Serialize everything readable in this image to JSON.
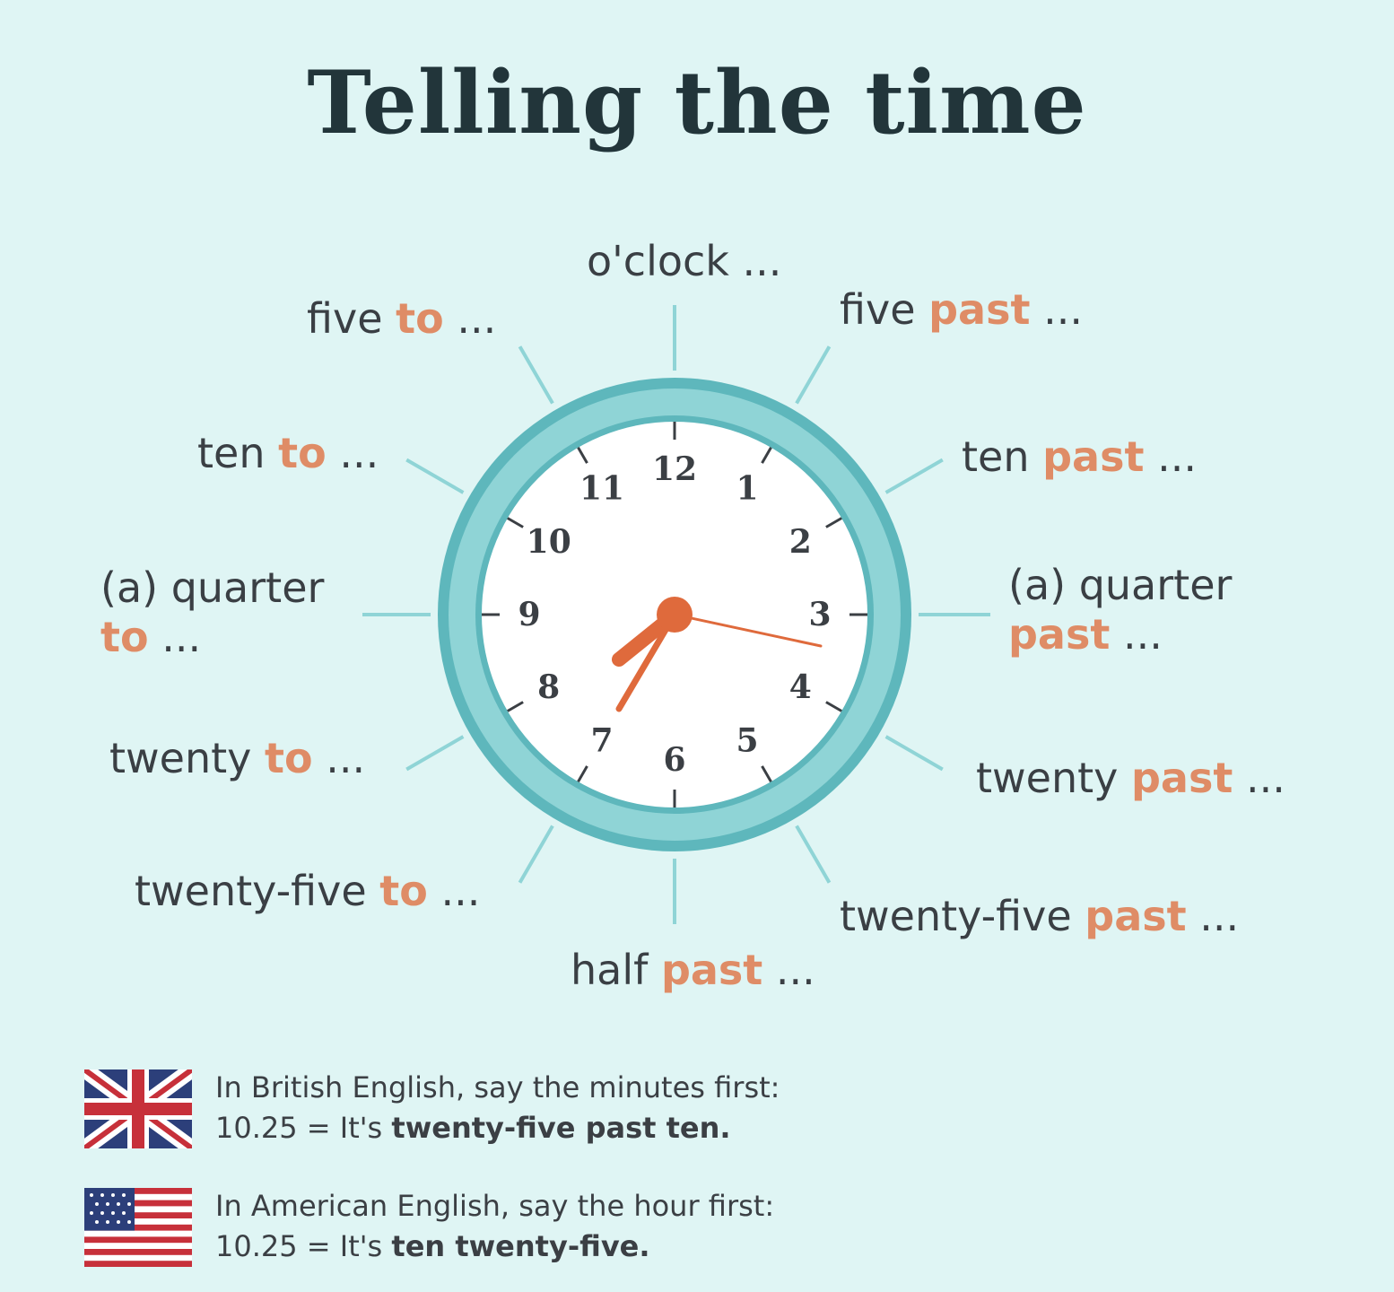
{
  "title": "Telling the time",
  "clock": {
    "numerals": [
      "12",
      "1",
      "2",
      "3",
      "4",
      "5",
      "6",
      "7",
      "8",
      "9",
      "10",
      "11"
    ]
  },
  "labels": {
    "oclock": {
      "text": "o'clock ..."
    },
    "five_past": {
      "text": "five",
      "accent": "past",
      "tail": "..."
    },
    "ten_past": {
      "text": "ten",
      "accent": "past",
      "tail": "..."
    },
    "quarter_past": {
      "text": "(a) quarter",
      "accent": "past",
      "tail": "..."
    },
    "twenty_past": {
      "text": "twenty",
      "accent": "past",
      "tail": "..."
    },
    "twentyfive_past": {
      "text": "twenty-five",
      "accent": "past",
      "tail": "..."
    },
    "half_past": {
      "text": "half",
      "accent": "past",
      "tail": "..."
    },
    "twentyfive_to": {
      "text": "twenty-five",
      "accent": "to",
      "tail": "..."
    },
    "twenty_to": {
      "text": "twenty",
      "accent": "to",
      "tail": "..."
    },
    "quarter_to": {
      "text": "(a) quarter",
      "accent": "to",
      "tail": "..."
    },
    "ten_to": {
      "text": "ten",
      "accent": "to",
      "tail": "..."
    },
    "five_to": {
      "text": "five",
      "accent": "to",
      "tail": "..."
    }
  },
  "notes": {
    "british": {
      "line1": "In British English, say the minutes first:",
      "line2_prefix": "10.25 = It's",
      "line2_bold": "twenty-five past ten."
    },
    "american": {
      "line1": "In American English, say the hour first:",
      "line2_prefix": "10.25 = It's",
      "line2_bold": "ten twenty-five."
    }
  },
  "colors": {
    "background": "#dff5f4",
    "rim": "#7fcdd0",
    "rim_outer": "#5eb7bc",
    "accent": "#df8c66",
    "text": "#3a3f44"
  },
  "icons": {
    "british_flag": "uk-flag-icon",
    "american_flag": "us-flag-icon"
  }
}
